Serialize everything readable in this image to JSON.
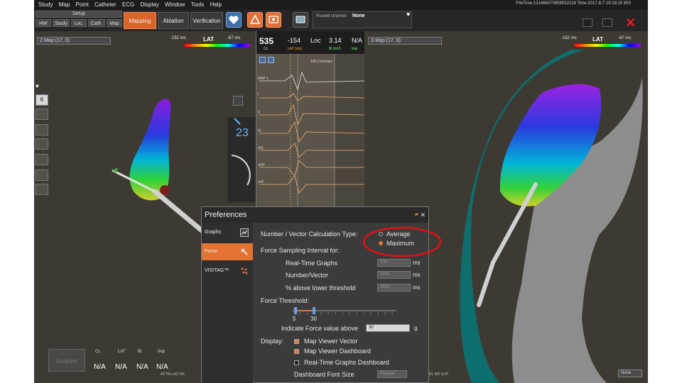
{
  "menu": [
    "Study",
    "Map",
    "Point",
    "Catheter",
    "ECG",
    "Display",
    "Window",
    "Tools",
    "Help"
  ],
  "file_time": "FileTime:131466070958532228 Time:2017-8-7 19:18:15 853",
  "toolbar": {
    "setup_label": "Setup",
    "setup_tabs": [
      "HW",
      "Study",
      "Loc.",
      "Cath.",
      "Map"
    ],
    "mapping": "Mapping",
    "ablation": "Ablation",
    "verification": "Verification",
    "routed_label": "Routed channel:",
    "routed_value": "None"
  },
  "left_map": {
    "selector": "2-Map (17, 0)",
    "lat_min": "-152 ms",
    "lat_label": "LAT",
    "lat_max": "-87 ms"
  },
  "right_map": {
    "selector": "2-Map (17, 0)",
    "lat_min": "-152 ms",
    "lat_label": "LAT",
    "lat_max": "-87 ms"
  },
  "left_tools": {
    "count": "6",
    "angle": "23"
  },
  "graphs": {
    "cl": "535",
    "cl_label": "CL",
    "lat": "-154",
    "lat_label": "LAT (ms)",
    "loc": "Loc",
    "bi": "3.14",
    "bi_label": "Bi (mV)",
    "imp": "N/A",
    "imp_label": "Imp",
    "speed": "100.0 mm/sec",
    "leads": [
      "MAP 1",
      "I",
      "II",
      "III",
      "aVL",
      "aVR",
      "aVF"
    ]
  },
  "preferences": {
    "title": "Preferences",
    "sidebar": [
      "Graphs",
      "Force",
      "VISITAG™"
    ],
    "calc_type_label": "Number / Vector Calculation Type:",
    "calc_options": [
      "Average",
      "Maximum"
    ],
    "sampling_label": "Force Sampling Interval for:",
    "sampling_rows": [
      {
        "label": "Real-Time Graphs",
        "value": "100",
        "unit": "ms"
      },
      {
        "label": "Number/Vector",
        "value": "1000",
        "unit": "ms"
      },
      {
        "label": "% above lower threshold",
        "value": "2500",
        "unit": "ms"
      }
    ],
    "threshold_label": "Force Threshold:",
    "threshold_low": "5",
    "threshold_high": "30",
    "indicate_label": "Indicate Force value above",
    "indicate_value": "30",
    "indicate_unit": "g",
    "display_label": "Display:",
    "display_options": [
      {
        "label": "Map Viewer Vector",
        "checked": true
      },
      {
        "label": "Map Viewer Dashboard",
        "checked": true
      },
      {
        "label": "Real-Time Graphs Dashboard",
        "checked": false
      }
    ],
    "font_size_label": "Dashboard Font Size",
    "font_size_value": "Regular"
  },
  "dashboard": {
    "acquire": "Acquire",
    "labels": [
      "CL",
      "LAT",
      "Bi",
      "Imp"
    ],
    "values": [
      "N/A",
      "N/A",
      "N/A",
      "N/A"
    ],
    "sub": "AP  PA  LAO  RA"
  },
  "right_bottom": {
    "select": "None",
    "sub": "RL  INF  SUP"
  }
}
